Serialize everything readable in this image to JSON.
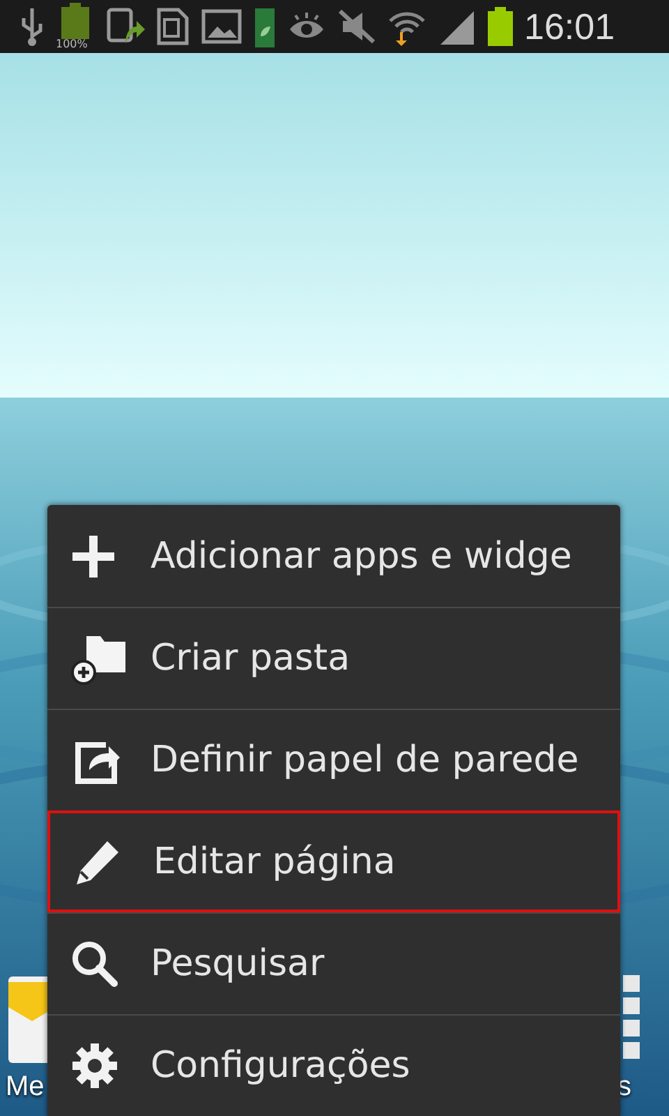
{
  "status_bar": {
    "battery_label": "100%",
    "time": "16:01"
  },
  "home_screen": {
    "left_app_label": "Me",
    "right_app_label": "s"
  },
  "menu": {
    "items": [
      {
        "label": "Adicionar apps e widge",
        "selected": false
      },
      {
        "label": "Criar pasta",
        "selected": false
      },
      {
        "label": "Definir papel de parede",
        "selected": false
      },
      {
        "label": "Editar página",
        "selected": true
      },
      {
        "label": "Pesquisar",
        "selected": false
      },
      {
        "label": "Configurações",
        "selected": false
      }
    ]
  }
}
